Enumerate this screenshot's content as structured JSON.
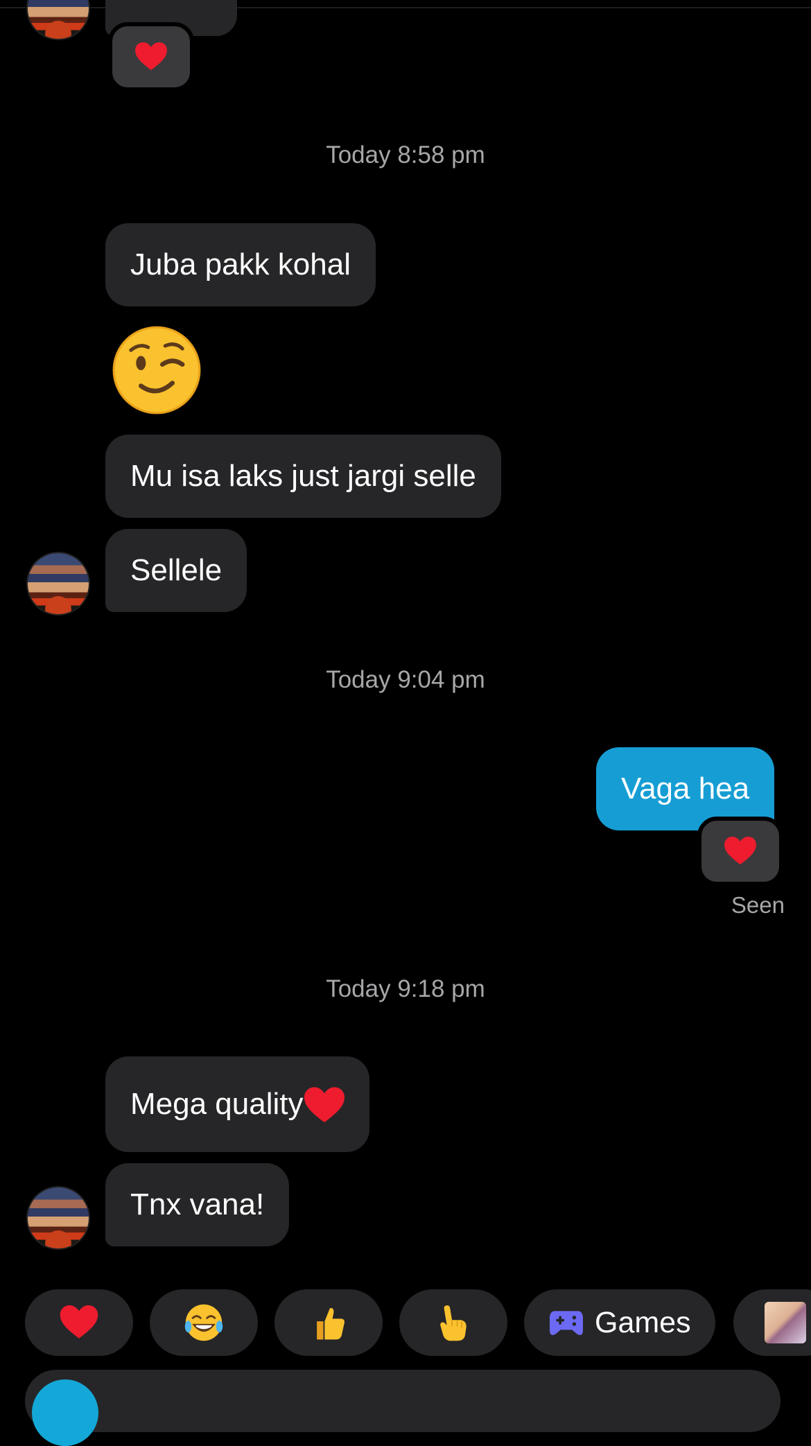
{
  "timestamps": [
    "Today 8:58 pm",
    "Today 9:04 pm",
    "Today 9:18 pm"
  ],
  "messages": {
    "m1": "Juba pakk kohal",
    "m2": "Mu isa laks just jargi selle",
    "m3": "Sellele",
    "sent": "Vaga hea",
    "m4": "Mega quality",
    "m5": "Tnx vana!"
  },
  "status": {
    "seen": "Seen"
  },
  "quick_replies": {
    "games_label": "Games"
  },
  "icons": {
    "heart": "heart-icon",
    "wink": "winking-face-icon",
    "laugh": "laughing-tears-icon",
    "thumbs": "thumbs-up-icon",
    "point": "pointing-hand-icon",
    "games": "gamepad-icon",
    "sticker": "sticker-thumbnail-icon"
  },
  "colors": {
    "sent_bubble": "#169ed4",
    "received_bubble": "#262628",
    "background": "#000000"
  }
}
